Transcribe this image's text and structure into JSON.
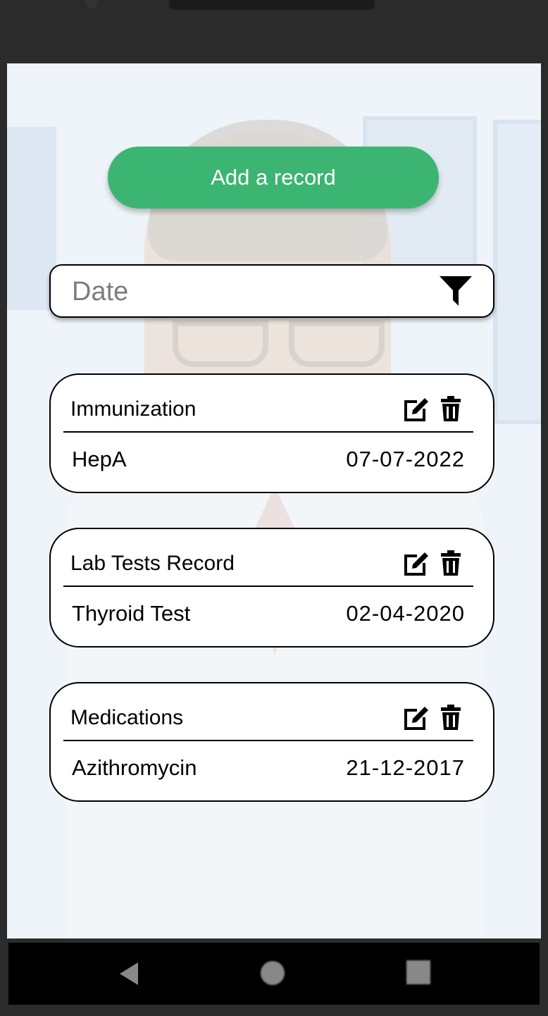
{
  "actions": {
    "add_record_label": "Add a record"
  },
  "filter": {
    "date_placeholder": "Date",
    "date_value": ""
  },
  "records": [
    {
      "category": "Immunization",
      "name": "HepA",
      "date": "07-07-2022"
    },
    {
      "category": "Lab Tests Record",
      "name": "Thyroid Test",
      "date": "02-04-2020"
    },
    {
      "category": "Medications",
      "name": "Azithromycin",
      "date": "21-12-2017"
    }
  ],
  "icons": {
    "filter": "filter-icon",
    "edit": "edit-icon",
    "delete": "trash-icon",
    "nav_back": "back-triangle-icon",
    "nav_home": "home-circle-icon",
    "nav_recent": "recent-apps-square-icon"
  },
  "colors": {
    "accent": "#3db572",
    "screen_background": "#eef4f9",
    "card_background": "#ffffff"
  }
}
